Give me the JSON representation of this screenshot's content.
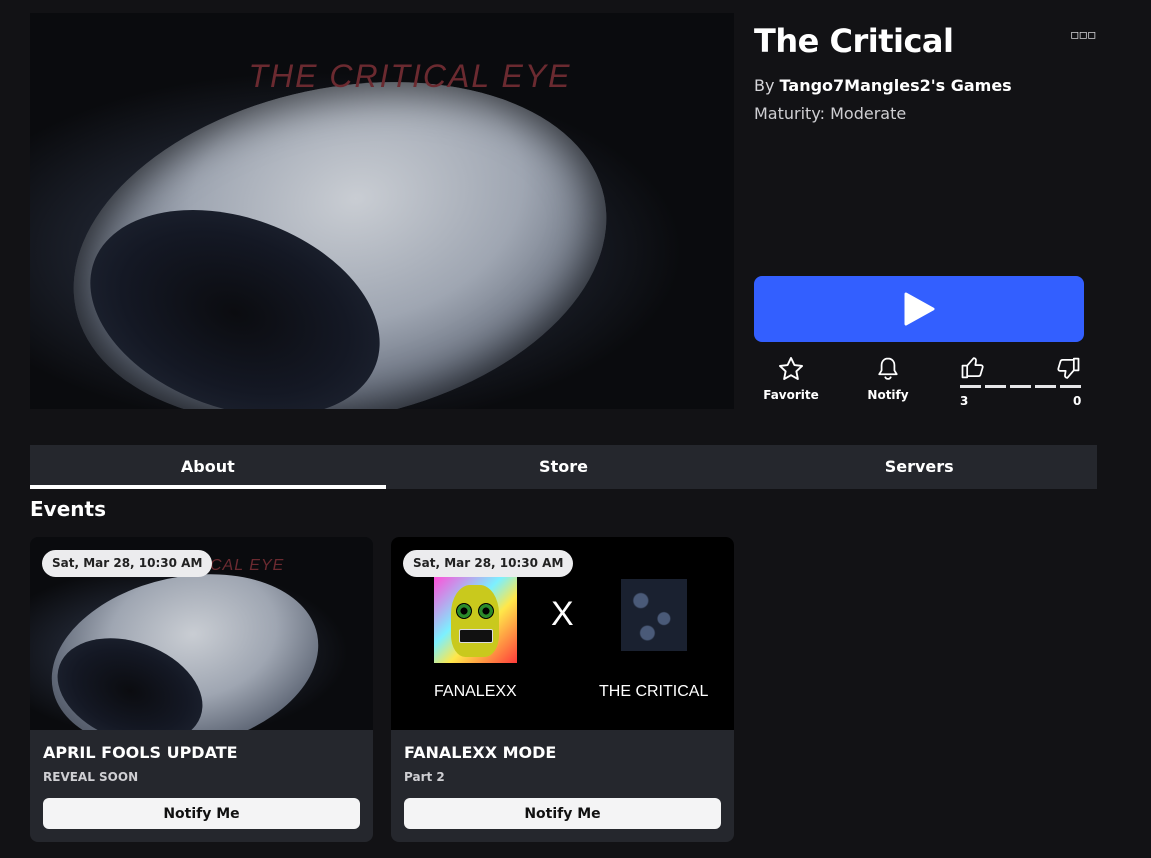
{
  "hero": {
    "image_text": "THE CRITICAL EYE"
  },
  "game": {
    "title": "The Critical",
    "by_prefix": "By",
    "creator": "Tango7Mangles2's Games",
    "maturity": "Maturity: Moderate",
    "more_icon": "ellipsis-icon"
  },
  "actions": {
    "favorite_label": "Favorite",
    "notify_label": "Notify",
    "upvotes": "3",
    "downvotes": "0"
  },
  "tabs": [
    {
      "label": "About",
      "active": true
    },
    {
      "label": "Store",
      "active": false
    },
    {
      "label": "Servers",
      "active": false
    }
  ],
  "events_heading": "Events",
  "events": [
    {
      "date": "Sat, Mar 28, 10:30 AM",
      "title": "APRIL FOOLS UPDATE",
      "subtitle": "REVEAL SOON",
      "button": "Notify Me",
      "image_text": "CAL EYE"
    },
    {
      "date": "Sat, Mar 28, 10:30 AM",
      "title": "FANALEXX MODE",
      "subtitle": "Part 2",
      "button": "Notify Me",
      "image_left_label": "FANALEXX",
      "image_mid": "X",
      "image_right_label": "THE CRITICAL"
    }
  ],
  "colors": {
    "play_button": "#335fff",
    "background": "#121215",
    "tab_bar": "#25272d"
  }
}
